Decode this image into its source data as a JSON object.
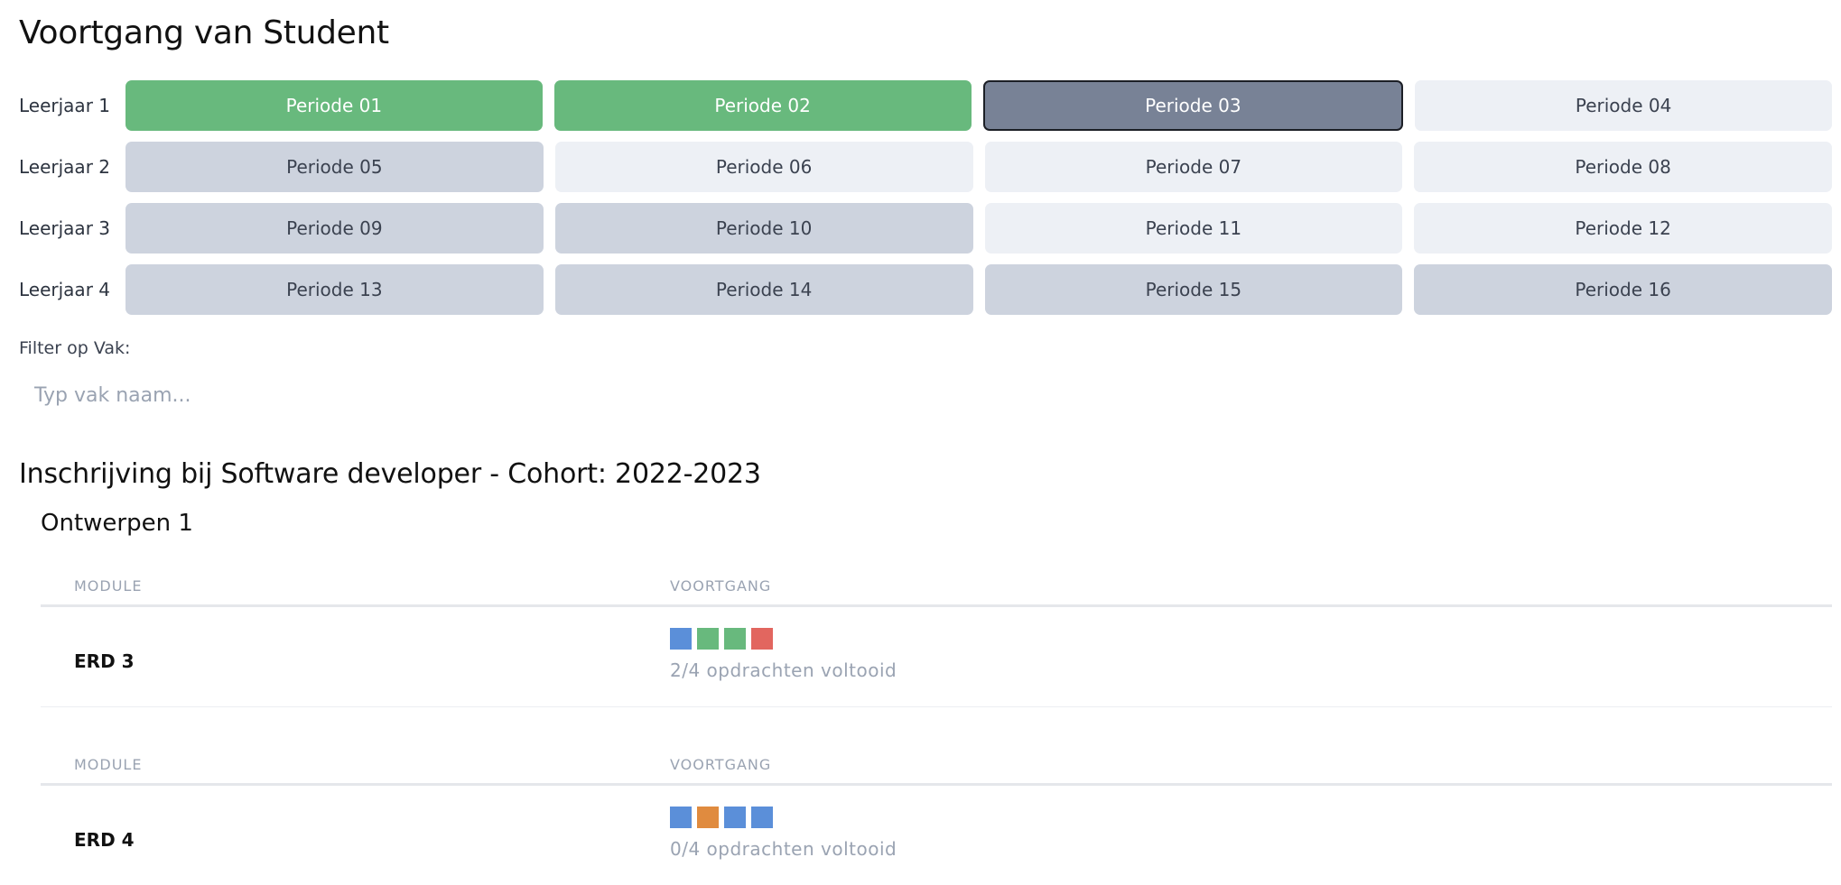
{
  "page_title": "Voortgang van Student",
  "years": [
    {
      "label": "Leerjaar 1",
      "periods": [
        {
          "label": "Periode 01",
          "state": "done"
        },
        {
          "label": "Periode 02",
          "state": "done"
        },
        {
          "label": "Periode 03",
          "state": "active"
        },
        {
          "label": "Periode 04",
          "state": "future"
        }
      ]
    },
    {
      "label": "Leerjaar 2",
      "periods": [
        {
          "label": "Periode 05",
          "state": "past"
        },
        {
          "label": "Periode 06",
          "state": "future"
        },
        {
          "label": "Periode 07",
          "state": "future"
        },
        {
          "label": "Periode 08",
          "state": "future"
        }
      ]
    },
    {
      "label": "Leerjaar 3",
      "periods": [
        {
          "label": "Periode 09",
          "state": "past"
        },
        {
          "label": "Periode 10",
          "state": "past"
        },
        {
          "label": "Periode 11",
          "state": "future"
        },
        {
          "label": "Periode 12",
          "state": "future"
        }
      ]
    },
    {
      "label": "Leerjaar 4",
      "periods": [
        {
          "label": "Periode 13",
          "state": "past"
        },
        {
          "label": "Periode 14",
          "state": "past"
        },
        {
          "label": "Periode 15",
          "state": "past"
        },
        {
          "label": "Periode 16",
          "state": "past"
        }
      ]
    }
  ],
  "filter": {
    "label": "Filter op Vak:",
    "placeholder": "Typ vak naam...",
    "value": ""
  },
  "enrollment_title": "Inschrijving bij Software developer - Cohort: 2022-2023",
  "course": {
    "title": "Ontwerpen 1",
    "tables": [
      {
        "headers": {
          "module": "MODULE",
          "progress": "VOORTGANG"
        },
        "row": {
          "module": "ERD 3",
          "progress_text": "2/4 opdrachten voltooid",
          "squares": [
            "blue",
            "green",
            "green",
            "red"
          ]
        }
      },
      {
        "headers": {
          "module": "MODULE",
          "progress": "VOORTGANG"
        },
        "row": {
          "module": "ERD 4",
          "progress_text": "0/4 opdrachten voltooid",
          "squares": [
            "blue",
            "orange",
            "blue",
            "blue"
          ]
        }
      }
    ]
  },
  "colors": {
    "done": "#68b97d",
    "active": "#788296",
    "past": "#cdd3de",
    "future": "#edf0f5",
    "square_blue": "#5b8fd9",
    "square_green": "#68b97d",
    "square_red": "#e2665f",
    "square_orange": "#e08b3f"
  }
}
